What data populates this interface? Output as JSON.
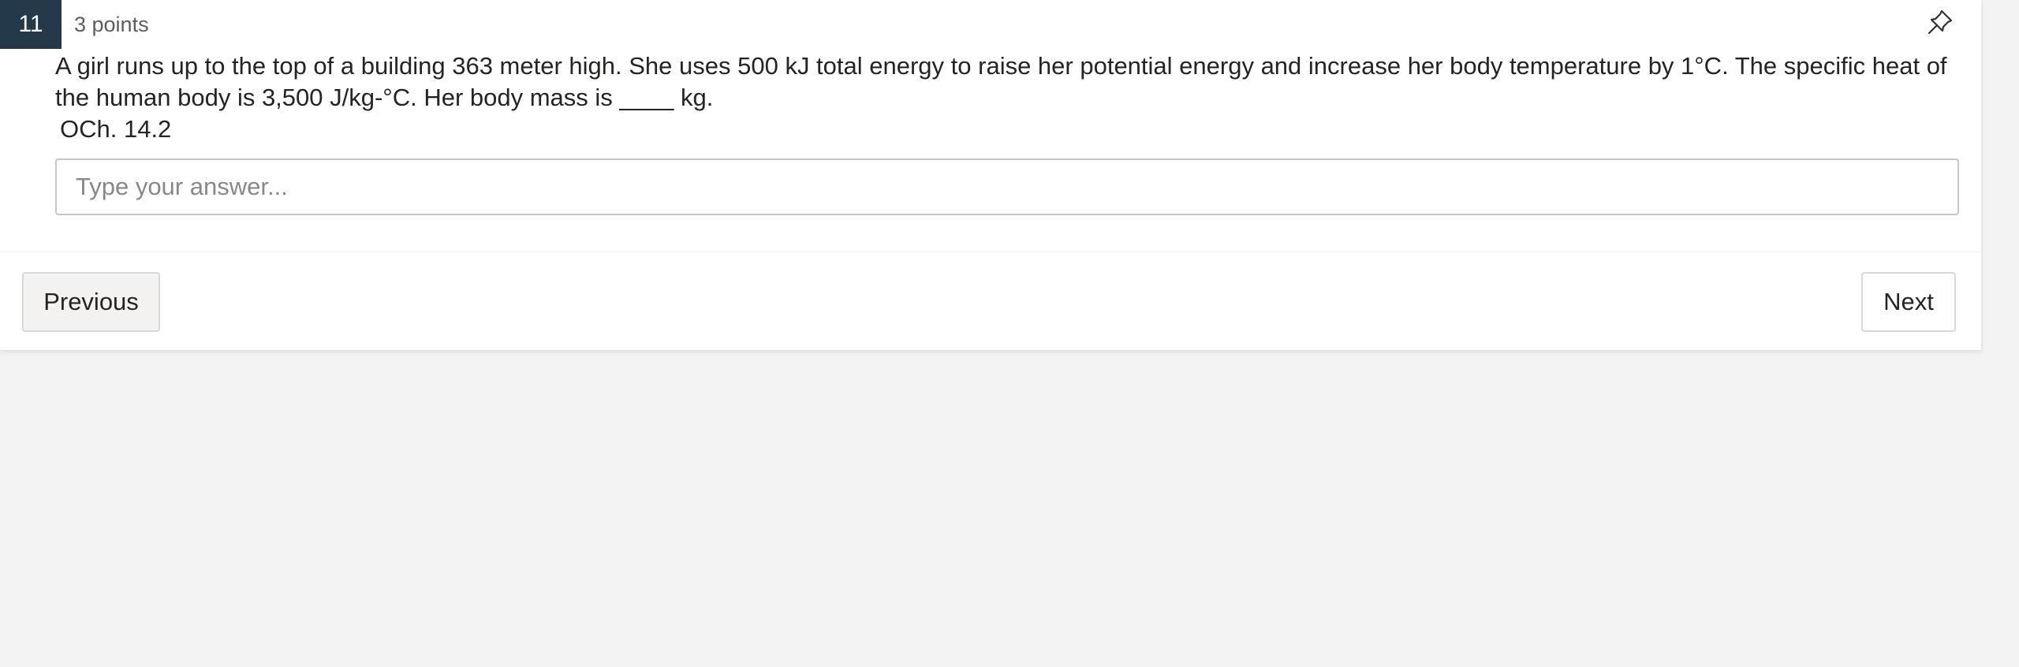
{
  "question": {
    "number": "11",
    "points": "3 points",
    "text": "A girl runs up to the top of a building 363 meter high.  She uses 500 kJ total energy to raise her potential energy and increase her body temperature by 1°C.  The specific heat of the human body is 3,500 J/kg-°C.  Her body mass is ____ kg.",
    "reference": "OCh. 14.2",
    "pin_icon": "pin-icon"
  },
  "answer": {
    "value": "",
    "placeholder": "Type your answer..."
  },
  "nav": {
    "previous_label": "Previous",
    "next_label": "Next"
  },
  "colors": {
    "question_number_bg": "#243a4a",
    "page_bg": "#f3f3f3",
    "card_bg": "#ffffff"
  }
}
